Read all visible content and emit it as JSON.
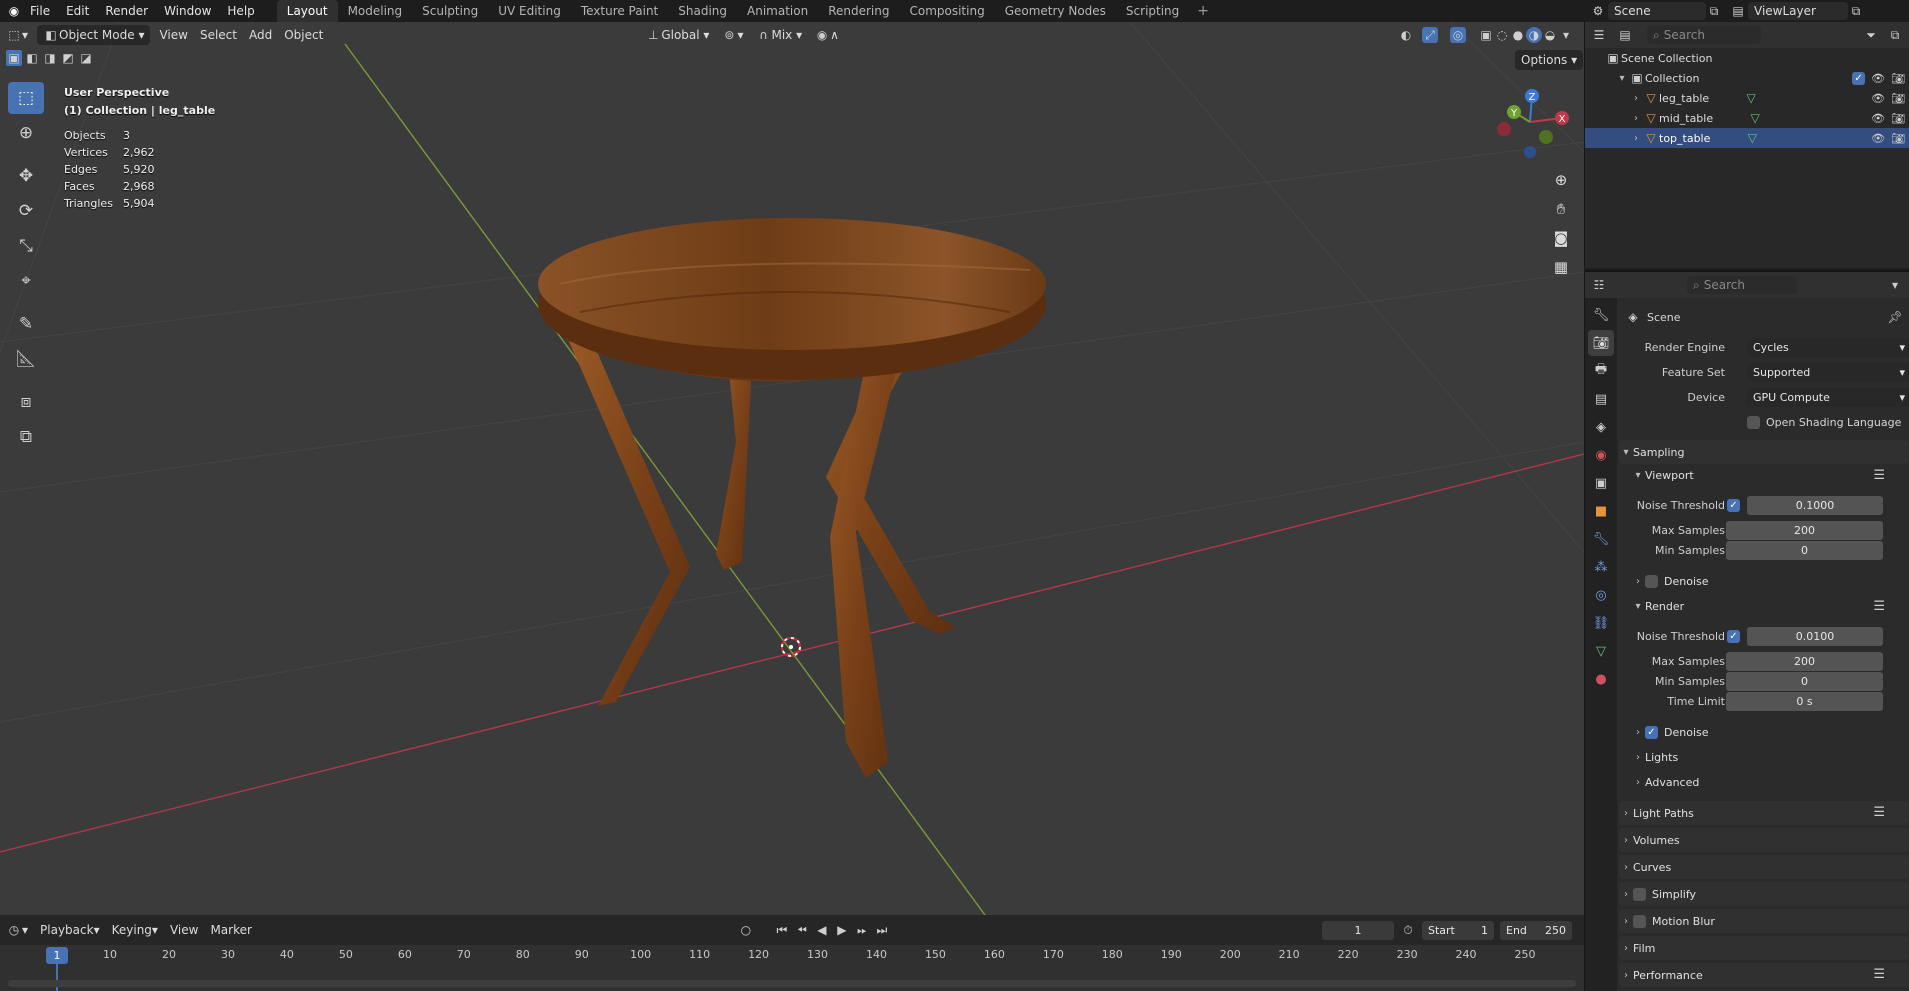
{
  "menu": [
    "File",
    "Edit",
    "Render",
    "Window",
    "Help"
  ],
  "workspaces": [
    "Layout",
    "Modeling",
    "Sculpting",
    "UV Editing",
    "Texture Paint",
    "Shading",
    "Animation",
    "Rendering",
    "Compositing",
    "Geometry Nodes",
    "Scripting"
  ],
  "active_workspace": "Layout",
  "scene": {
    "name": "Scene",
    "view_layer": "ViewLayer"
  },
  "viewport": {
    "mode": "Object Mode",
    "menus": [
      "View",
      "Select",
      "Add",
      "Object"
    ],
    "transform_orientation": "Global",
    "snap_mode": "Mix",
    "options_label": "Options",
    "perspective": "User Perspective",
    "context": "(1) Collection | leg_table",
    "stats": [
      {
        "label": "Objects",
        "value": "3"
      },
      {
        "label": "Vertices",
        "value": "2,962"
      },
      {
        "label": "Edges",
        "value": "5,920"
      },
      {
        "label": "Faces",
        "value": "2,968"
      },
      {
        "label": "Triangles",
        "value": "5,904"
      }
    ],
    "gizmo": {
      "x": "X",
      "y": "Y",
      "z": "Z"
    },
    "colors": {
      "x_axis": "#b0384a",
      "y_axis": "#7a9a35",
      "selection": "#4772b3"
    }
  },
  "outliner": {
    "search_placeholder": "Search",
    "scene_collection": "Scene Collection",
    "collection": "Collection",
    "objects": [
      {
        "name": "leg_table",
        "selected": false
      },
      {
        "name": "mid_table",
        "selected": false
      },
      {
        "name": "top_table",
        "selected": true
      }
    ]
  },
  "properties": {
    "search_placeholder": "Search",
    "context": "Scene",
    "render_engine_label": "Render Engine",
    "render_engine": "Cycles",
    "feature_set_label": "Feature Set",
    "feature_set": "Supported",
    "device_label": "Device",
    "device": "GPU Compute",
    "osl_label": "Open Shading Language",
    "sampling": "Sampling",
    "viewport_sub": "Viewport",
    "viewport_noise_label": "Noise Threshold",
    "viewport_noise": "0.1000",
    "viewport_max_label": "Max Samples",
    "viewport_max": "200",
    "viewport_min_label": "Min Samples",
    "viewport_min": "0",
    "viewport_denoise": "Denoise",
    "render_sub": "Render",
    "render_noise_label": "Noise Threshold",
    "render_noise": "0.0100",
    "render_max_label": "Max Samples",
    "render_max": "200",
    "render_min_label": "Min Samples",
    "render_min": "0",
    "time_limit_label": "Time Limit",
    "time_limit": "0 s",
    "render_denoise": "Denoise",
    "lights": "Lights",
    "advanced": "Advanced",
    "panels": [
      "Light Paths",
      "Volumes",
      "Curves",
      "Simplify",
      "Motion Blur",
      "Film",
      "Performance"
    ]
  },
  "timeline": {
    "menus": [
      "Playback",
      "Keying",
      "View",
      "Marker"
    ],
    "current_frame": "1",
    "start_label": "Start",
    "start": "1",
    "end_label": "End",
    "end": "250",
    "ticks": [
      "10",
      "20",
      "30",
      "40",
      "50",
      "60",
      "70",
      "80",
      "90",
      "100",
      "110",
      "120",
      "130",
      "140",
      "150",
      "160",
      "170",
      "180",
      "190",
      "200",
      "210",
      "220",
      "230",
      "240",
      "250"
    ]
  }
}
